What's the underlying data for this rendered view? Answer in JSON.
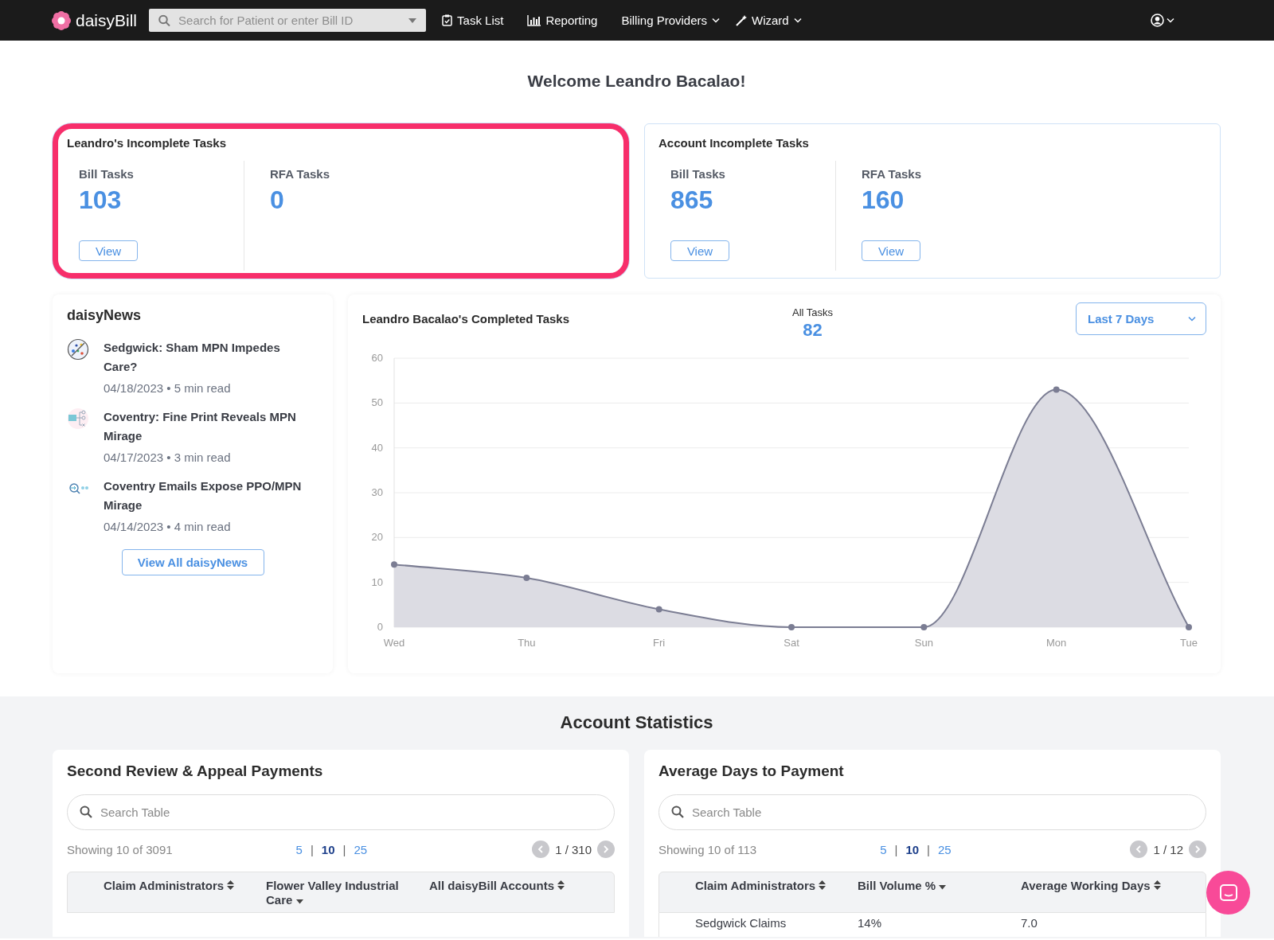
{
  "nav": {
    "logo": "daisy**Bill**",
    "search": {
      "placeholder": "Search for Patient or enter Bill ID"
    },
    "items": [
      {
        "label": "Task List",
        "kind": "clipboard"
      },
      {
        "label": "Reporting",
        "kind": "chart"
      },
      {
        "label": "Billing Providers",
        "kind": "dropdown"
      },
      {
        "label": "Wizard",
        "kind": "wand"
      }
    ]
  },
  "welcome": "Welcome Leandro Bacalao!",
  "task_cards": [
    {
      "title": "Leandro's Incomplete Tasks",
      "highlighted": true,
      "groups": [
        {
          "label": "Bill Tasks",
          "count": "103",
          "button": "View"
        },
        {
          "label": "RFA Tasks",
          "count": "0"
        }
      ]
    },
    {
      "title": "Account Incomplete Tasks",
      "highlighted": false,
      "groups": [
        {
          "label": "Bill Tasks",
          "count": "865",
          "button": "View"
        },
        {
          "label": "RFA Tasks",
          "count": "160",
          "button": "View"
        }
      ]
    }
  ],
  "news": {
    "title": "daisyNews",
    "items": [
      {
        "title": "Sedgwick: Sham MPN Impedes Care?",
        "meta": "04/18/2023 • 5 min read"
      },
      {
        "title": "Coventry: Fine Print Reveals MPN Mirage",
        "meta": "04/17/2023 • 3 min read"
      },
      {
        "title": "Coventry Emails Expose PPO/MPN Mirage",
        "meta": "04/14/2023 • 4 min read"
      }
    ],
    "button": "View All daisyNews"
  },
  "completed": {
    "title": "Leandro Bacalao's Completed Tasks",
    "total_label": "All Tasks",
    "total": "82",
    "range": "Last 7 Days",
    "chart_data": {
      "type": "area",
      "categories": [
        "Wed",
        "Thu",
        "Fri",
        "Sat",
        "Sun",
        "Mon",
        "Tue"
      ],
      "values": [
        14,
        11,
        4,
        0,
        0,
        53,
        0
      ],
      "ylim": [
        0,
        60
      ],
      "yticks": [
        0,
        10,
        20,
        30,
        40,
        50,
        60
      ],
      "grid": true
    }
  },
  "statistics": {
    "title": "Account Statistics",
    "tables": [
      {
        "title": "Second Review & Appeal Payments",
        "search": {
          "placeholder": "Search Table"
        },
        "showing": "Showing 10 of 3091",
        "page_sizes": [
          {
            "label": "5",
            "selected": false
          },
          {
            "label": "10",
            "selected": true
          },
          {
            "label": "25",
            "selected": false
          }
        ],
        "separator": "|",
        "page": "1 / 310",
        "columns": [
          {
            "label": "Claim Administrators",
            "sorted": false
          },
          {
            "label": "Flower Valley Industrial Care",
            "sorted": true
          },
          {
            "label": "All daisyBill Accounts",
            "sorted": false
          }
        ]
      },
      {
        "title": "Average Days to Payment",
        "search": {
          "placeholder": "Search Table"
        },
        "showing": "Showing 10 of 113",
        "page_sizes": [
          {
            "label": "5",
            "selected": false
          },
          {
            "label": "10",
            "selected": true
          },
          {
            "label": "25",
            "selected": false
          }
        ],
        "separator": "|",
        "page": "1 / 12",
        "columns": [
          {
            "label": "Claim Administrators",
            "sorted": false
          },
          {
            "label": "Bill Volume %",
            "sorted": true
          },
          {
            "label": "Average Working Days",
            "sorted": false
          }
        ],
        "rows": [
          [
            "Sedgwick Claims",
            "14%",
            "7.0"
          ]
        ]
      }
    ]
  }
}
